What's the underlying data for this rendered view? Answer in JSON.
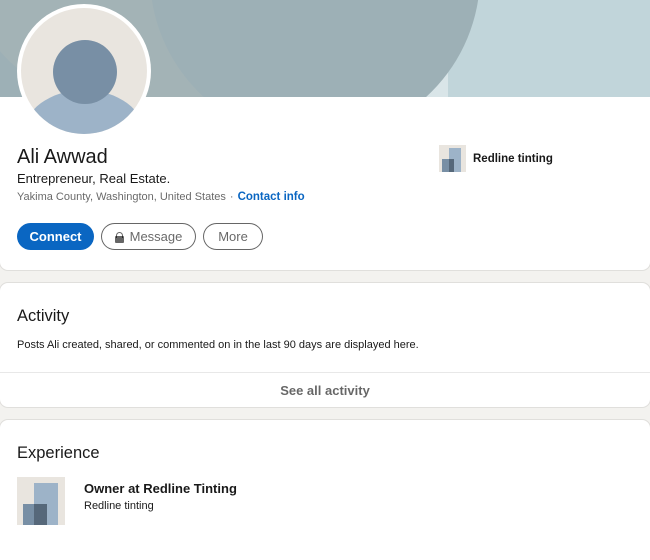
{
  "profile": {
    "name": "Ali Awwad",
    "headline": "Entrepreneur, Real Estate.",
    "location": "Yakima County, Washington, United States",
    "separator": "·",
    "contact_info_label": "Contact info",
    "current_company": "Redline tinting"
  },
  "actions": {
    "connect_label": "Connect",
    "message_label": "Message",
    "more_label": "More"
  },
  "activity": {
    "title": "Activity",
    "description": "Posts Ali created, shared, or commented on in the last 90 days are displayed here.",
    "see_all_label": "See all activity"
  },
  "experience": {
    "title": "Experience",
    "items": [
      {
        "role": "Owner at Redline Tinting",
        "company": "Redline tinting"
      }
    ]
  },
  "colors": {
    "accent": "#0a66c2",
    "banner": "#9db0b6",
    "page_background": "#f3f2ef"
  },
  "icons": {
    "lock": "lock-icon",
    "avatar": "default-avatar",
    "company_logo": "company-logo-placeholder"
  }
}
